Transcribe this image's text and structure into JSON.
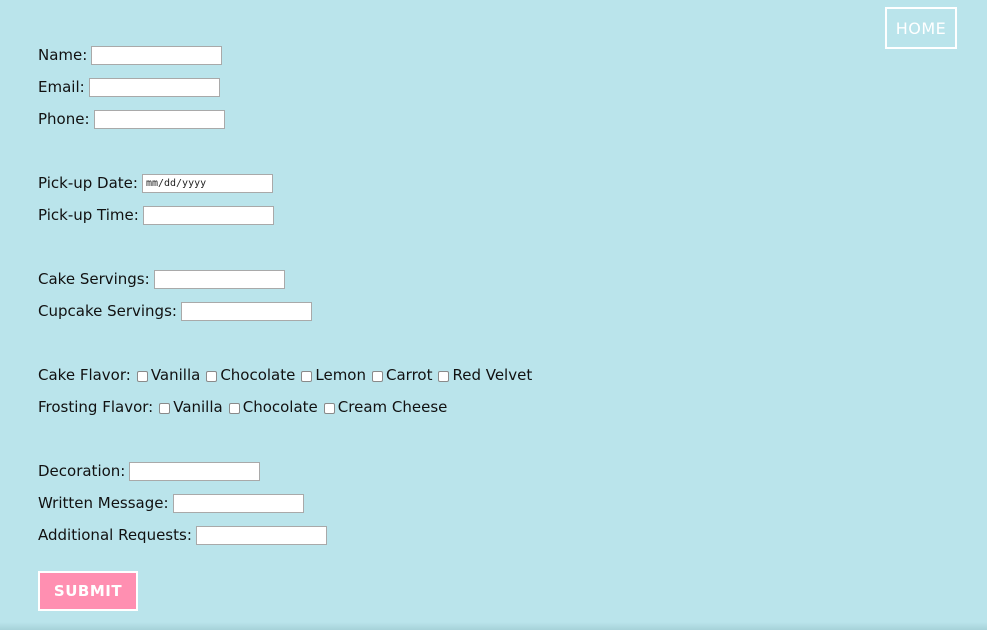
{
  "nav": {
    "home_label": "HOME"
  },
  "form": {
    "name_label": "Name:",
    "email_label": "Email:",
    "phone_label": "Phone:",
    "pickup_date_label": "Pick-up Date:",
    "pickup_date_placeholder": "mm/dd/yyyy",
    "pickup_time_label": "Pick-up Time:",
    "cake_servings_label": "Cake Servings:",
    "cupcake_servings_label": "Cupcake Servings:",
    "cake_flavor_label": "Cake Flavor:",
    "cake_flavors": [
      "Vanilla",
      "Chocolate",
      "Lemon",
      "Carrot",
      "Red Velvet"
    ],
    "frosting_flavor_label": "Frosting Flavor:",
    "frosting_flavors": [
      "Vanilla",
      "Chocolate",
      "Cream Cheese"
    ],
    "decoration_label": "Decoration:",
    "written_message_label": "Written Message:",
    "additional_requests_label": "Additional Requests:",
    "submit_label": "SUBMIT"
  },
  "colors": {
    "background": "#bae4eb",
    "submit_fill": "#ff8fb1",
    "button_border": "#ffffff"
  }
}
